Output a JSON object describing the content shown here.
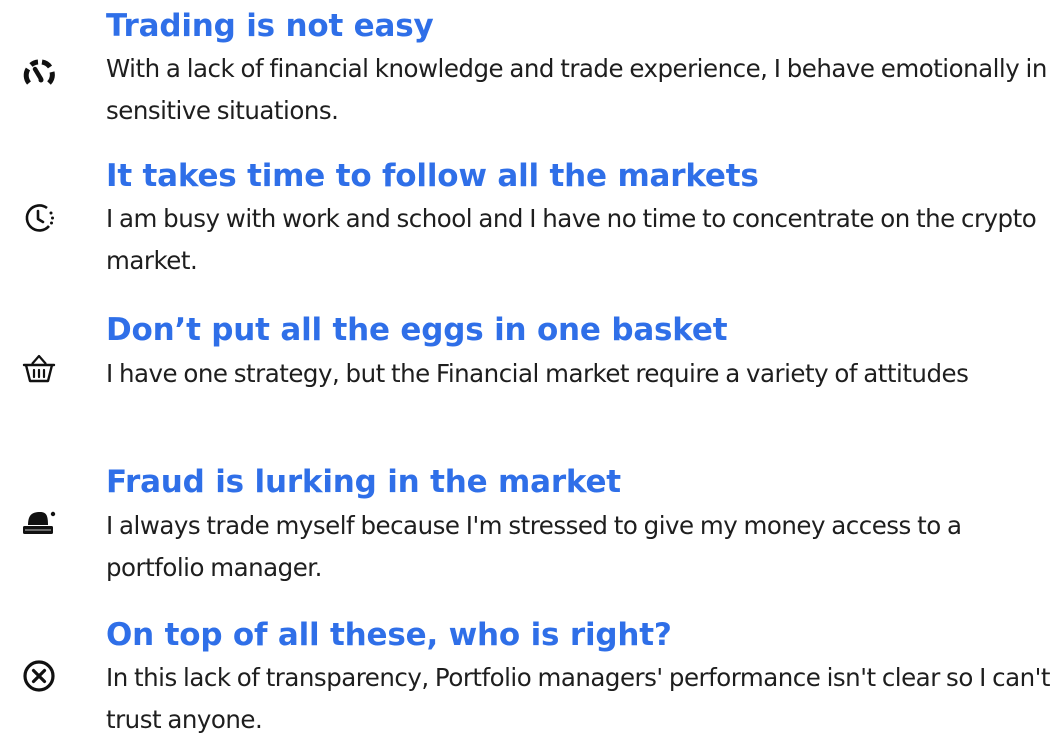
{
  "items": [
    {
      "icon": "broken-gauge-icon",
      "title": "Trading is not easy",
      "description": "With a lack of financial knowledge and trade experience, I behave emotionally in sensitive situations."
    },
    {
      "icon": "clock-icon",
      "title": "It takes time to follow all the markets",
      "description": "I am busy with work and school and I have no time to concentrate on the crypto market."
    },
    {
      "icon": "basket-icon",
      "title": "Don’t put all the eggs in one basket",
      "description": "I have one strategy, but the Financial market require a variety of attitudes"
    },
    {
      "icon": "spy-hat-icon",
      "title": "Fraud is lurking in the market",
      "description": "I always trade myself because I'm stressed to give my money access to a portfolio manager."
    },
    {
      "icon": "close-circle-icon",
      "title": "On top of all these, who is right?",
      "description": "In this lack of transparency, Portfolio managers' performance isn't clear so I can't trust anyone."
    }
  ],
  "colors": {
    "title": "#2f6fe8",
    "text": "#1e1e1e",
    "icon": "#111111"
  }
}
